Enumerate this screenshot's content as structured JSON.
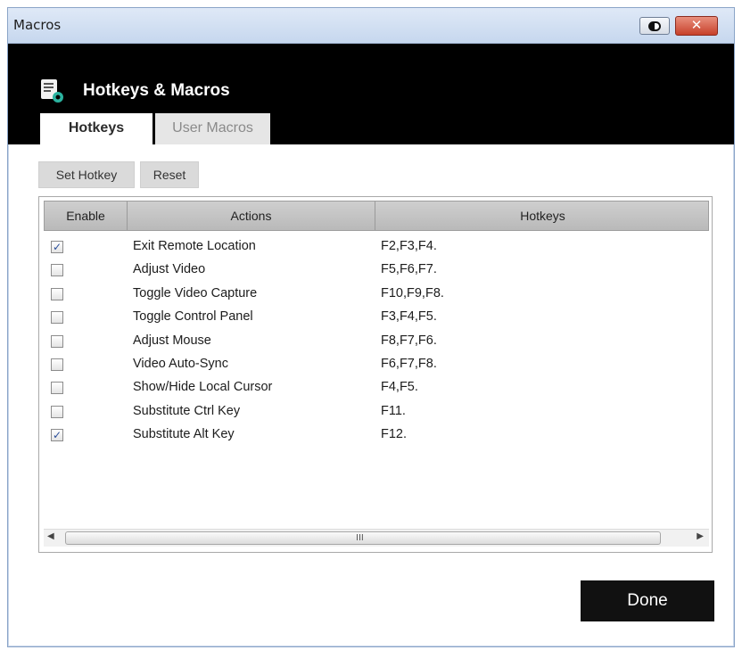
{
  "window": {
    "title": "Macros",
    "close_glyph": "✕"
  },
  "header": {
    "title": "Hotkeys & Macros",
    "icon": "script-settings-icon"
  },
  "tabs": [
    {
      "label": "Hotkeys",
      "active": true
    },
    {
      "label": "User Macros",
      "active": false
    }
  ],
  "toolbar": {
    "set_hotkey_label": "Set Hotkey",
    "reset_label": "Reset"
  },
  "table": {
    "columns": [
      "Enable",
      "Actions",
      "Hotkeys"
    ],
    "rows": [
      {
        "enabled": true,
        "check": "✓",
        "action": "Exit Remote Location",
        "hotkeys": "F2,F3,F4."
      },
      {
        "enabled": false,
        "check": "",
        "action": "Adjust Video",
        "hotkeys": "F5,F6,F7."
      },
      {
        "enabled": false,
        "check": "",
        "action": "Toggle Video Capture",
        "hotkeys": "F10,F9,F8."
      },
      {
        "enabled": false,
        "check": "",
        "action": "Toggle Control Panel",
        "hotkeys": "F3,F4,F5."
      },
      {
        "enabled": false,
        "check": "",
        "action": "Adjust Mouse",
        "hotkeys": "F8,F7,F6."
      },
      {
        "enabled": false,
        "check": "",
        "action": "Video Auto-Sync",
        "hotkeys": "F6,F7,F8."
      },
      {
        "enabled": false,
        "check": "",
        "action": "Show/Hide Local Cursor",
        "hotkeys": "F4,F5."
      },
      {
        "enabled": false,
        "check": "",
        "action": "Substitute Ctrl Key",
        "hotkeys": "F11."
      },
      {
        "enabled": true,
        "check": "✓",
        "action": "Substitute Alt Key",
        "hotkeys": "F12."
      }
    ]
  },
  "scrollbar": {
    "left_arrow": "◀",
    "right_arrow": "▶",
    "grip": "III"
  },
  "footer": {
    "done_label": "Done"
  },
  "colors": {
    "header_bg": "#000000",
    "done_bg": "#111111",
    "close_red": "#c7402a",
    "check_blue": "#2a4e9a"
  }
}
